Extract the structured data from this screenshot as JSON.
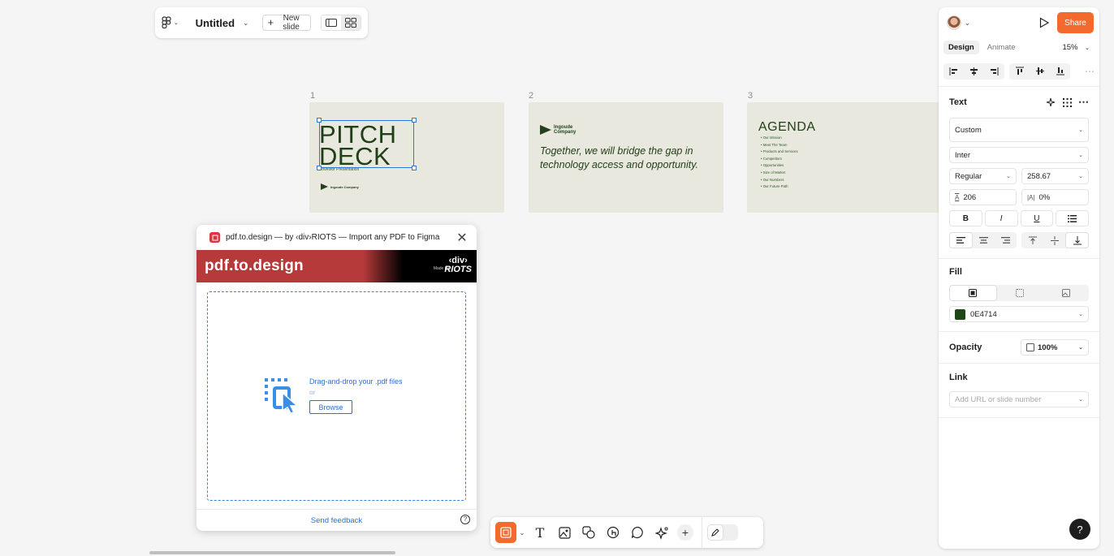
{
  "app": {
    "title": "Untitled",
    "new_slide_label": "New slide"
  },
  "slides": [
    {
      "number": "1",
      "title": "PITCH DECK",
      "subtitle": "Investor Presentation",
      "company": "Ingoude Company"
    },
    {
      "number": "2",
      "company": "Ingoude Company",
      "text": "Together, we will bridge the gap in technology access and opportunity."
    },
    {
      "number": "3",
      "title": "AGENDA",
      "items": [
        "Our Mission",
        "Meet The Team",
        "Products and Services",
        "Competitors",
        "Opportunities",
        "Size of Market",
        "Our Numbers",
        "Our Future Path"
      ]
    }
  ],
  "plugin": {
    "window_title": "pdf.to.design — by ‹div›RIOTS — Import any PDF to Figma",
    "brand": "pdf.to.design",
    "made_by": "Made by",
    "riots_top": "‹div›",
    "riots_bottom": "RIOTS",
    "drop_text": "Drag-and-drop your .pdf files",
    "or": "or",
    "browse_label": "Browse",
    "feedback_label": "Send feedback",
    "help": "?"
  },
  "panel": {
    "share_label": "Share",
    "tabs": [
      "Design",
      "Animate"
    ],
    "zoom": "15%",
    "text_section": {
      "title": "Text",
      "style": "Custom",
      "font_family": "Inter",
      "font_weight": "Regular",
      "font_size": "258.67",
      "line_height": "206",
      "letter_spacing": "0%",
      "bold": "B",
      "italic": "I",
      "underline": "U"
    },
    "fill_section": {
      "title": "Fill",
      "color_hex": "0E4714",
      "swatch": "#1e4716"
    },
    "opacity_section": {
      "title": "Opacity",
      "value": "100%"
    },
    "link_section": {
      "title": "Link",
      "placeholder": "Add URL or slide number"
    },
    "help": "?"
  },
  "colors": {
    "accent": "#f26a2e",
    "selection": "#2e77d6",
    "slide_bg": "#e8e8df",
    "brand_red": "#b73a3a"
  }
}
